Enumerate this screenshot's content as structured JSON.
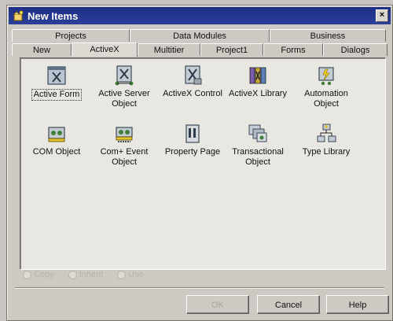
{
  "window": {
    "title": "New Items",
    "close_glyph": "×"
  },
  "tabs_back": [
    "Projects",
    "Data Modules",
    "Business"
  ],
  "tabs_front": [
    "New",
    "ActiveX",
    "Multitier",
    "Project1",
    "Forms",
    "Dialogs"
  ],
  "active_tab": "ActiveX",
  "items": [
    {
      "label": "Active Form",
      "icon": "active-form-icon",
      "selected": true
    },
    {
      "label": "Active Server Object",
      "icon": "active-server-object-icon"
    },
    {
      "label": "ActiveX Control",
      "icon": "activex-control-icon"
    },
    {
      "label": "ActiveX Library",
      "icon": "activex-library-icon"
    },
    {
      "label": "Automation Object",
      "icon": "automation-object-icon"
    },
    {
      "label": "COM Object",
      "icon": "com-object-icon"
    },
    {
      "label": "Com+ Event Object",
      "icon": "com-event-object-icon"
    },
    {
      "label": "Property Page",
      "icon": "property-page-icon"
    },
    {
      "label": "Transactional Object",
      "icon": "transactional-object-icon"
    },
    {
      "label": "Type Library",
      "icon": "type-library-icon"
    }
  ],
  "options": {
    "copy": "Copy",
    "inherit": "Inherit",
    "use": "Use"
  },
  "buttons": {
    "ok": "OK",
    "cancel": "Cancel",
    "help": "Help"
  }
}
